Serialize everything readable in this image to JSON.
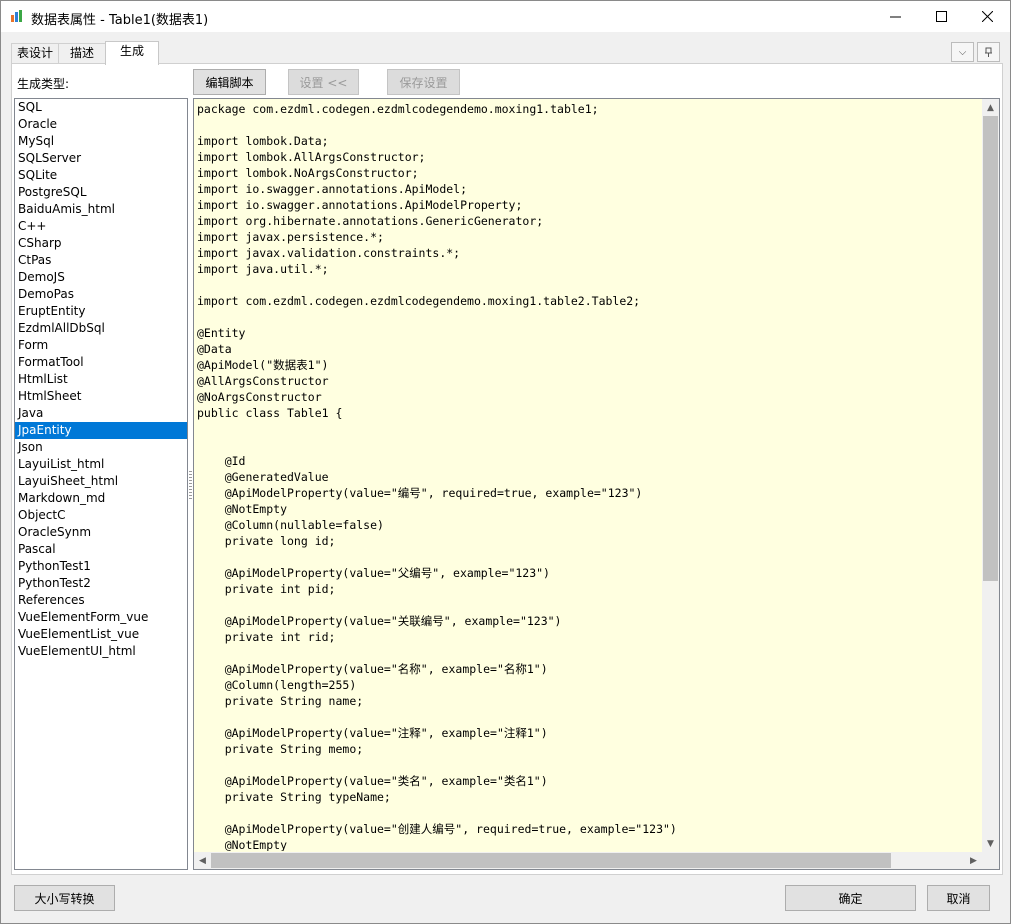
{
  "window": {
    "title": "数据表属性 - Table1(数据表1)",
    "minimize_icon": "minimize-icon",
    "maximize_icon": "maximize-icon",
    "close_icon": "close-icon"
  },
  "tabs": [
    {
      "label": "表设计"
    },
    {
      "label": "描述"
    },
    {
      "label": "生成"
    }
  ],
  "panel_buttons": {
    "collapse_icon": "chevron-down-icon",
    "pin_icon": "pin-icon"
  },
  "generate": {
    "type_label": "生成类型:",
    "toolbar": {
      "edit_script": "编辑脚本",
      "settings": "设置 <<",
      "save_settings": "保存设置"
    },
    "types": [
      "SQL",
      "Oracle",
      "MySql",
      "SQLServer",
      "SQLite",
      "PostgreSQL",
      "BaiduAmis_html",
      "C++",
      "CSharp",
      "CtPas",
      "DemoJS",
      "DemoPas",
      "EruptEntity",
      "EzdmlAllDbSql",
      "Form",
      "FormatTool",
      "HtmlList",
      "HtmlSheet",
      "Java",
      "JpaEntity",
      "Json",
      "LayuiList_html",
      "LayuiSheet_html",
      "Markdown_md",
      "ObjectC",
      "OracleSynm",
      "Pascal",
      "PythonTest1",
      "PythonTest2",
      "References",
      "VueElementForm_vue",
      "VueElementList_vue",
      "VueElementUI_html"
    ],
    "selected_type": "JpaEntity",
    "code_lines": [
      "package com.ezdml.codegen.ezdmlcodegendemo.moxing1.table1;",
      "",
      "import lombok.Data;",
      "import lombok.AllArgsConstructor;",
      "import lombok.NoArgsConstructor;",
      "import io.swagger.annotations.ApiModel;",
      "import io.swagger.annotations.ApiModelProperty;",
      "import org.hibernate.annotations.GenericGenerator;",
      "import javax.persistence.*;",
      "import javax.validation.constraints.*;",
      "import java.util.*;",
      "",
      "import com.ezdml.codegen.ezdmlcodegendemo.moxing1.table2.Table2;",
      "",
      "@Entity",
      "@Data",
      "@ApiModel(\"数据表1\")",
      "@AllArgsConstructor",
      "@NoArgsConstructor",
      "public class Table1 {",
      "",
      "",
      "    @Id",
      "    @GeneratedValue",
      "    @ApiModelProperty(value=\"编号\", required=true, example=\"123\")",
      "    @NotEmpty",
      "    @Column(nullable=false)",
      "    private long id;",
      "",
      "    @ApiModelProperty(value=\"父编号\", example=\"123\")",
      "    private int pid;",
      "",
      "    @ApiModelProperty(value=\"关联编号\", example=\"123\")",
      "    private int rid;",
      "",
      "    @ApiModelProperty(value=\"名称\", example=\"名称1\")",
      "    @Column(length=255)",
      "    private String name;",
      "",
      "    @ApiModelProperty(value=\"注释\", example=\"注释1\")",
      "    private String memo;",
      "",
      "    @ApiModelProperty(value=\"类名\", example=\"类名1\")",
      "    private String typeName;",
      "",
      "    @ApiModelProperty(value=\"创建人编号\", required=true, example=\"123\")",
      "    @NotEmpty"
    ]
  },
  "footer": {
    "case_convert": "大小写转换",
    "ok": "确定",
    "cancel": "取消"
  },
  "colors": {
    "code_bg": "#ffffe0",
    "selection": "#0078d7"
  }
}
